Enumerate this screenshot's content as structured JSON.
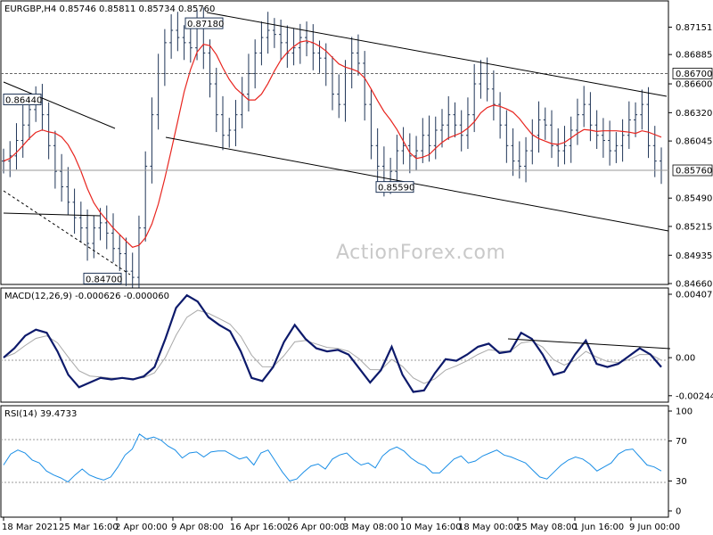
{
  "chart_data": [
    {
      "panel": "price",
      "type": "ohlc",
      "title": "EURGBP,H4",
      "header_values": [
        "0.85746",
        "0.85811",
        "0.85734",
        "0.85760"
      ],
      "ylim": [
        0.8466,
        0.8738
      ],
      "y_ticks": [
        "0.87151",
        "0.86885",
        "0.86600",
        "0.86320",
        "0.86045",
        "0.85760",
        "0.85490",
        "0.85215",
        "0.84935",
        "0.84660"
      ],
      "y_values": [
        0.87151,
        0.86885,
        0.866,
        0.8632,
        0.86045,
        0.8576,
        0.8549,
        0.85215,
        0.84935,
        0.8466
      ],
      "tick_labels_at_axis": [
        "0.87151",
        "0.86885",
        "0.86600",
        "0.86320",
        "0.86045",
        "0.85490",
        "0.85215",
        "0.84935",
        "0.84660"
      ],
      "current_price_label": "0.85760",
      "dashed_level_label": "0.86700",
      "dashed_level": 0.867,
      "current_price": 0.8576,
      "annotations": [
        {
          "text": "0.87180",
          "value": 0.8718
        },
        {
          "text": "0.86440",
          "value": 0.8644
        },
        {
          "text": "0.85590",
          "value": 0.8559
        },
        {
          "text": "0.84700",
          "value": 0.847
        }
      ],
      "moving_average_color": "#e8251f",
      "bar_color": "#1f3557",
      "close_series": [
        0.8585,
        0.859,
        0.8605,
        0.862,
        0.8635,
        0.8642,
        0.863,
        0.86,
        0.8575,
        0.856,
        0.8545,
        0.853,
        0.852,
        0.8505,
        0.852,
        0.8525,
        0.8515,
        0.85,
        0.8495,
        0.8478,
        0.8472,
        0.852,
        0.858,
        0.863,
        0.867,
        0.87,
        0.8712,
        0.8705,
        0.87,
        0.8695,
        0.8715,
        0.869,
        0.866,
        0.863,
        0.861,
        0.8615,
        0.863,
        0.865,
        0.867,
        0.869,
        0.8705,
        0.8712,
        0.8708,
        0.87,
        0.869,
        0.8695,
        0.8705,
        0.87,
        0.869,
        0.8685,
        0.867,
        0.865,
        0.864,
        0.867,
        0.869,
        0.868,
        0.864,
        0.86,
        0.858,
        0.8565,
        0.8575,
        0.8595,
        0.86,
        0.859,
        0.8595,
        0.861,
        0.86,
        0.8615,
        0.862,
        0.863,
        0.862,
        0.861,
        0.863,
        0.866,
        0.867,
        0.8655,
        0.864,
        0.862,
        0.86,
        0.8585,
        0.858,
        0.8595,
        0.861,
        0.8625,
        0.862,
        0.86,
        0.8595,
        0.86,
        0.8615,
        0.863,
        0.864,
        0.862,
        0.861,
        0.8605,
        0.8595,
        0.86,
        0.861,
        0.8625,
        0.863,
        0.864,
        0.86,
        0.8585,
        0.8576
      ]
    },
    {
      "panel": "macd",
      "type": "line",
      "title": "MACD(12,26,9) -0.000626 -0.000060",
      "ylim": [
        -0.0028,
        0.0043
      ],
      "y_ticks": [
        "0.004071",
        "0.00",
        "-0.002445"
      ],
      "y_values": [
        0.004071,
        0.0,
        -0.002445
      ],
      "main_color": "#0d1a6b",
      "signal_color": "#a8a8a8",
      "series_main": [
        0.0,
        0.0006,
        0.0014,
        0.0018,
        0.0016,
        0.0004,
        -0.0011,
        -0.0019,
        -0.0016,
        -0.0013,
        -0.0014,
        -0.0013,
        -0.0014,
        -0.0012,
        -0.0006,
        0.0012,
        0.0032,
        0.004,
        0.0036,
        0.0026,
        0.0021,
        0.0017,
        0.0004,
        -0.0013,
        -0.0015,
        -0.0006,
        0.001,
        0.0021,
        0.0012,
        0.0006,
        0.0004,
        0.0005,
        0.0002,
        -0.0007,
        -0.0016,
        -0.0008,
        0.0007,
        -0.0011,
        -0.0022,
        -0.0021,
        -0.001,
        -0.0001,
        -0.0002,
        0.0002,
        0.0007,
        0.0009,
        0.0003,
        0.0004,
        0.0016,
        0.0012,
        0.0002,
        -0.0011,
        -0.0009,
        0.0002,
        0.0011,
        -0.0004,
        -0.0006,
        -0.0004,
        0.0001,
        0.0006,
        0.0002,
        -0.0006
      ],
      "trendline_label_count": 0
    },
    {
      "panel": "rsi",
      "type": "line",
      "title": "RSI(14) 39.4733",
      "ylim": [
        0,
        100
      ],
      "y_ticks": [
        "100",
        "70",
        "30",
        "0"
      ],
      "y_values": [
        100,
        70,
        30,
        0
      ],
      "levels": [
        70,
        50,
        30
      ],
      "line_color": "#1a8ee6",
      "series": [
        48,
        55,
        60,
        58,
        52,
        50,
        38,
        35,
        33,
        30,
        38,
        40,
        35,
        33,
        32,
        36,
        42,
        55,
        62,
        78,
        74,
        72,
        70,
        65,
        62,
        55,
        56,
        58,
        54,
        60,
        62,
        58,
        55,
        52,
        55,
        48,
        56,
        60,
        50,
        40,
        32,
        30,
        38,
        45,
        48,
        44,
        50,
        55,
        58,
        52,
        48,
        46,
        42,
        55,
        62,
        66,
        58,
        52,
        48,
        46,
        40,
        36,
        44,
        52,
        56,
        50,
        48,
        54,
        58,
        62,
        58,
        52,
        50,
        48,
        42,
        36,
        30,
        38,
        46,
        52,
        56,
        50,
        46,
        40,
        45,
        50,
        55,
        60,
        62,
        55,
        48,
        42,
        39
      ]
    }
  ],
  "x_axis": {
    "labels": [
      "18 Mar 2021",
      "25 Mar 16:00",
      "2 Apr 00:00",
      "9 Apr 08:00",
      "16 Apr 16:00",
      "26 Apr 00:00",
      "3 May 08:00",
      "10 May 16:00",
      "18 May 00:00",
      "25 May 08:00",
      "1 Jun 16:00",
      "9 Jun 00:00"
    ]
  },
  "watermark": "ActionForex.com",
  "colors": {
    "frame": "#000000",
    "grid": "#b8b8b8",
    "box_fill": "#1f3557",
    "box_text": "#ffffff",
    "trendline": "#000000"
  }
}
